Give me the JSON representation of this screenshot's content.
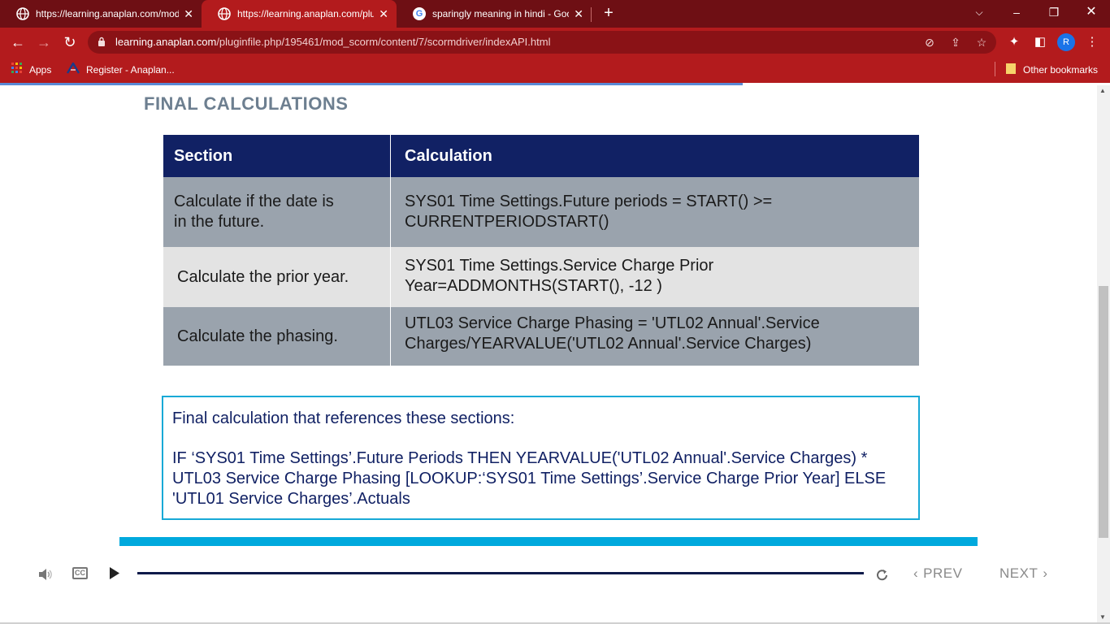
{
  "browser": {
    "tabs": [
      {
        "title": "https://learning.anaplan.com/mod",
        "favicon": "globe-icon"
      },
      {
        "title": "https://learning.anaplan.com/plu",
        "favicon": "globe-icon",
        "active": true
      },
      {
        "title": "sparingly meaning in hindi - Goo",
        "favicon": "google-icon"
      }
    ],
    "url_host": "learning.anaplan.com",
    "url_path": "/pluginfile.php/195461/mod_scorm/content/7/scormdriver/indexAPI.html",
    "avatar_letter": "R",
    "bookmarks": [
      {
        "label": "Apps",
        "icon": "apps-grid-icon"
      },
      {
        "label": "Register - Anaplan...",
        "icon": "anaplan-icon"
      }
    ],
    "other_bookmarks": "Other bookmarks",
    "theme_color": "#b31b1d"
  },
  "page": {
    "heading": "FINAL CALCULATIONS",
    "table": {
      "headers": [
        "Section",
        "Calculation"
      ],
      "rows": [
        {
          "section": "Calculate if the date is in the future.",
          "calculation": "SYS01 Time Settings.Future periods = START() >= CURRENTPERIODSTART()"
        },
        {
          "section": "Calculate the prior year.",
          "calculation": "SYS01 Time Settings.Service Charge Prior Year=ADDMONTHS(START(), -12 )"
        },
        {
          "section": "Calculate the phasing.",
          "calculation": "UTL03 Service Charge Phasing = 'UTL02 Annual'.Service Charges/YEARVALUE('UTL02 Annual'.Service Charges)"
        }
      ],
      "header_color": "#112164"
    },
    "final_box": {
      "intro": "Final calculation that references these sections:",
      "formula": "IF ‘SYS01 Time Settings’.Future Periods THEN YEARVALUE('UTL02 Annual'.Service Charges) * UTL03 Service Charge Phasing [LOOKUP:‘SYS01 Time Settings’.Service Charge Prior Year] ELSE 'UTL01 Service Charges’.Actuals",
      "border_color": "#18a9d6"
    }
  },
  "player": {
    "prev_label": "PREV",
    "next_label": "NEXT",
    "cc_label": "CC",
    "progress_color": "#0e1a4a"
  }
}
